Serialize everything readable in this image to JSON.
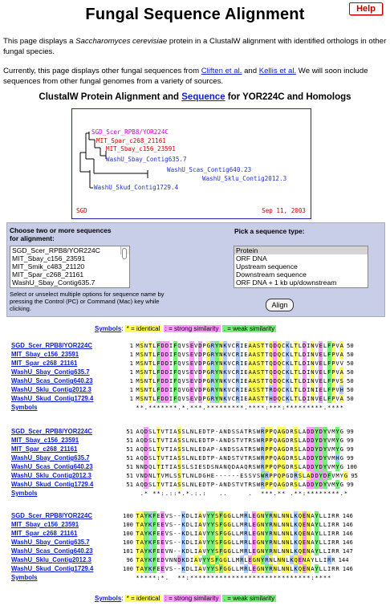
{
  "header": {
    "title": "Fungal Sequence Alignment",
    "help_label": "Help"
  },
  "intro": {
    "p1_pre": "This page displays a ",
    "p1_species": "Saccharomyces cerevisiae",
    "p1_post": " protein in a ClustalW alignment with identified orthologs in other fungal species.",
    "p2_pre": "Currently, this page displays other fungal sequences from ",
    "p2_link1": "Cliften et al.",
    "p2_mid": " and ",
    "p2_link2": "Kellis et al.",
    "p2_post": " We will soon include sequences from other fungal genomes from a variety of sources."
  },
  "section": {
    "pre": "ClustalW Protein Alignment and ",
    "link": "Sequence",
    "post": " for YOR224C and Homologs"
  },
  "tree": {
    "labels": [
      {
        "text": "SGD_Scer_RPB8/YOR224C",
        "color": "#cc00cc"
      },
      {
        "text": "MIT_Spar_c268_21161",
        "color": "#dd0000"
      },
      {
        "text": "MIT_Sbay_c156_23591",
        "color": "#dd0000"
      },
      {
        "text": "WashU_Sbay_Contig635.7",
        "color": "#2233cc"
      },
      {
        "text": "WashU_Scas_Contig640.23",
        "color": "#2233cc"
      },
      {
        "text": "WashU_Sklu_Contig2012.3",
        "color": "#2233cc"
      },
      {
        "text": "WashU_Skud_Contig1729.4",
        "color": "#2233cc"
      }
    ],
    "footer_left": "SGD",
    "footer_right": "Sep 11, 2003"
  },
  "form": {
    "choose_label": "Choose two or more sequences for alignment:",
    "sequences": [
      "SGD_Scer_RPB8/YOR224C",
      "MIT_Sbay_c156_23591",
      "MIT_Smik_c483_21120",
      "MIT_Spar_c268_21161",
      "WashU_Sbay_Contig635.7"
    ],
    "selected_sequence": "SGD_Scer_RPB8/YOR224C",
    "note": "Select or unselect multiple options for sequence name by pressing the Control (PC) or Command (Mac) key while clicking.",
    "type_label": "Pick a sequence type:",
    "types": [
      "Protein",
      "ORF DNA",
      "Upstream sequence",
      "Downstream sequence",
      "ORF DNA + 1 kb up/downstream"
    ],
    "selected_type": "Protein",
    "align_button": "Align"
  },
  "legend": {
    "symbols": "Symbols",
    "identical": "* = identical",
    "strong": ": = strong similarity",
    "weak": ". = weak similarity"
  },
  "colors": {
    "yellow": "#ffff55",
    "pink": "#ff99ff",
    "green": "#77ee77",
    "link": "#1020d0"
  },
  "alignment": {
    "names": [
      "SGD_Scer_RPB8/YOR224C",
      "MIT_Sbay_c156_23591",
      "MIT_Spar_c268_21161",
      "WashU_Sbay_Contig635.7",
      "WashU_Scas_Contig640.23",
      "WashU_Sklu_Contig2012.3",
      "WashU_Skud_Contig1729.4"
    ],
    "symbols_label": "Symbols",
    "blocks": [
      {
        "starts": [
          "1",
          "1",
          "1",
          "1",
          "1",
          "1",
          "1"
        ],
        "seqs": [
          "MSNTLFDDIFQVSEVDPGRYNKVCRIEAASTTQDQCKLTLDINVELFPVA",
          "MSNTLFDDIFQVSEVDPGRYNKVCRIEAASTTQDQCKLTLDINVELFPVA",
          "MSNTLFDDIFQVSEVDPGRYNKVCRIEAASTTQDQCKLTLDINVELFPVV",
          "MSNTLFDDIFQVSEVDPGRYNKVCRIEAASTTQDQCKLTLDINVELFPVA",
          "MSNTLFDDIFQVSEVDPGRYNKVCRIEAASTTQDQCKLTLDINVELFPVS",
          "MSNTLFDDIFQVGEVDPGRYNKVCRIEASSTTRDQCKLTLDINIELFPVH",
          "MSNTLFDDIFQVSEVDPGRYNKVCRIEAASTTHDQCKLTLDINVELFPVA"
        ],
        "ends": [
          "50",
          "50",
          "50",
          "50",
          "50",
          "50",
          "50"
        ],
        "symbols": "**.*******.*.***.*********.****:***:*********.****"
      },
      {
        "starts": [
          "51",
          "51",
          "51",
          "51",
          "51",
          "51",
          "51"
        ],
        "seqs": [
          "AQDSLTVTIASSLNLEDTP-ANDSSATRSWRPPQAGDRSLADDYDYVMYG",
          "AQDSLTVTIASSLNLEDTP-ANDSTVTRSWRPPQAGDRSLADDYDYVMYG",
          "AQDSLTVTIASSLNLEDAP-ANDSSATRSWRPPQAGDRSLADDYDYVMYG",
          "AQDSLTVTIASSLNLEDTP-ANDSTVTRSWRPPQAGDRSLADDYDYVMHG",
          "NNDQLTITIASSLSIESDSNANQDAAQRSWRPPQPGDRSLADDYDYVMYG",
          "VNDNLTVMLSSTLNLDGHE------ESSVSWRPPQPGDRSLADDYDFVMYG",
          "AQDSLTVTIASSLNLEDTP-ANDSTVTRSWRPPQAGDRSLADDYDYVMYG"
        ],
        "ends": [
          "99",
          "99",
          "99",
          "99",
          "100",
          "95",
          "99"
        ],
        "symbols": " .* **:.::*.*.:.:   ..     .  ***.** .**:********.*"
      },
      {
        "starts": [
          "100",
          "100",
          "100",
          "100",
          "101",
          "96",
          "100"
        ],
        "seqs": [
          "TAYKFEEVS--KDLIAVYYSFGGLLMRLEGNYRNLNNLKQENAYLLIRR",
          "TAYKFEEVS--KDLIAVYYSFGGLLMRLEGNYRNLNNLKQENAYLLIRR",
          "TAYKFEEVS--KDLIAVYYSFGGLLMRLEGNYRNLNNLKQENAYLLIRR",
          "TAYKFEEVS--KDLIAVYYSFGGLLMRLEGNYRNLNNLKQENAYLLIRR",
          "TAYKFEEVN--KDLIAVYYSFGGLLMRLEGNYRNLNNLKQENAYLLIRR",
          "TAYKFEDVNNDKDIAVYYSFGGLLMRLEGNYRNLNNLKQENAYLLIRR",
          "TAYKFEEVS--KDLIAVYYSFGGLLMRLEGNYRNLNNLKQENAYLLIRR"
        ],
        "ends": [
          "146",
          "146",
          "146",
          "146",
          "147",
          "144",
          "146"
        ],
        "symbols": "*****:*.  **:*****************************:****"
      }
    ]
  }
}
